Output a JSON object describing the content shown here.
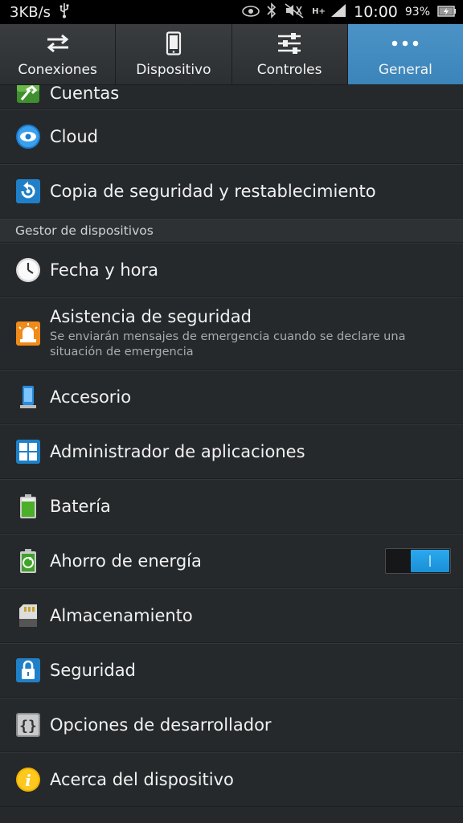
{
  "status": {
    "speed": "3KB/s",
    "network": "H+",
    "time": "10:00",
    "battery": "93%"
  },
  "tabs": [
    {
      "label": "Conexiones",
      "icon": "swap-arrows-icon",
      "active": false
    },
    {
      "label": "Dispositivo",
      "icon": "phone-icon",
      "active": false
    },
    {
      "label": "Controles",
      "icon": "sliders-icon",
      "active": false
    },
    {
      "label": "General",
      "icon": "more-dots-icon",
      "active": true
    }
  ],
  "items_top": [
    {
      "title": "Cuentas",
      "icon": "accounts-key-icon"
    },
    {
      "title": "Cloud",
      "icon": "cloud-icon"
    },
    {
      "title": "Copia de seguridad y restablecimiento",
      "icon": "backup-restore-icon"
    }
  ],
  "section_title": "Gestor de dispositivos",
  "items": [
    {
      "title": "Fecha y hora",
      "icon": "clock-icon"
    },
    {
      "title": "Asistencia de seguridad",
      "subtitle": "Se enviarán mensajes de emergencia cuando se declare una situación de emergencia",
      "icon": "siren-icon"
    },
    {
      "title": "Accesorio",
      "icon": "accessory-icon"
    },
    {
      "title": "Administrador de aplicaciones",
      "icon": "app-grid-icon"
    },
    {
      "title": "Batería",
      "icon": "battery-icon"
    },
    {
      "title": "Ahorro de energía",
      "icon": "power-saving-icon",
      "toggle_on": true
    },
    {
      "title": "Almacenamiento",
      "icon": "sd-card-icon"
    },
    {
      "title": "Seguridad",
      "icon": "lock-icon"
    },
    {
      "title": "Opciones de desarrollador",
      "icon": "developer-braces-icon"
    },
    {
      "title": "Acerca del dispositivo",
      "icon": "info-icon"
    }
  ],
  "colors": {
    "accent": "#3b84ba",
    "toggle_on": "#1a8fd6",
    "background": "#26292c"
  }
}
